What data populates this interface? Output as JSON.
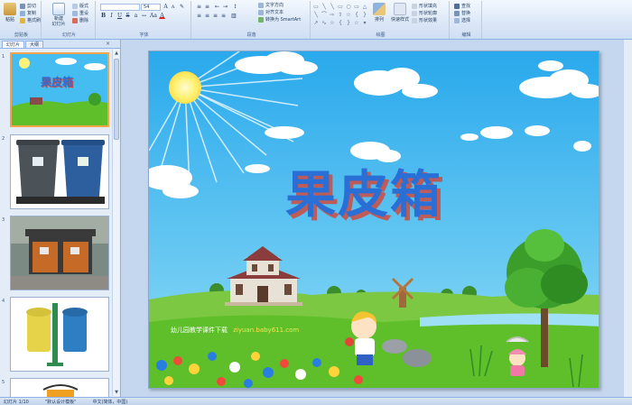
{
  "ribbon": {
    "clipboard": {
      "label": "剪贴板",
      "paste": "粘贴",
      "cut": "剪切",
      "copy": "复制",
      "format_painter": "格式刷"
    },
    "slides": {
      "label": "幻灯片",
      "new_slide": "新建\n幻灯片",
      "layout": "版式",
      "reset": "重设",
      "delete": "删除"
    },
    "font": {
      "label": "字体",
      "font_size": "54"
    },
    "paragraph": {
      "label": "段落",
      "text_direction": "文字方向",
      "align_text": "对齐文本",
      "smartart": "转换为 SmartArt"
    },
    "drawing": {
      "label": "绘图",
      "arrange": "排列",
      "quick_styles": "快速样式",
      "shape_fill": "形状填充",
      "shape_outline": "形状轮廓",
      "shape_effects": "形状效果"
    },
    "editing": {
      "label": "编辑",
      "find": "查找",
      "replace": "替换",
      "select": "选择"
    }
  },
  "pane": {
    "tab_slides": "幻灯片",
    "tab_outline": "大纲",
    "close": "×",
    "thumb1_title": "果皮箱"
  },
  "slide": {
    "title": "果皮箱",
    "footer_cn": "幼儿园教学课件下载",
    "footer_url": "ziyuan.baby611.com"
  },
  "status": {
    "slide_info": "幻灯片 1/10",
    "theme": "\"默认设计模板\"",
    "language": "中文(简体，中国)"
  },
  "colors": {
    "title_blue": "#2a6fd6",
    "title_shadow": "#d14b3e",
    "sky": "#38b6ef",
    "grass": "#5fbf2a",
    "selection": "#f2a54a"
  }
}
